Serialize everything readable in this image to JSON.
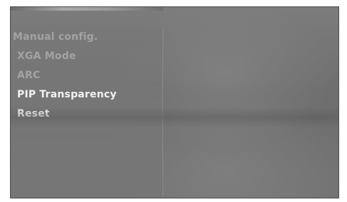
{
  "menu": {
    "items": [
      {
        "label": "Manual config.",
        "state": "dim"
      },
      {
        "label": "XGA Mode",
        "state": "dim"
      },
      {
        "label": "ARC",
        "state": "dim"
      },
      {
        "label": "PIP Transparency",
        "state": "bright"
      },
      {
        "label": "Reset",
        "state": "bright"
      }
    ]
  },
  "colors": {
    "dim_text": "#a3a3a3",
    "bright_text": "#f2f2f2",
    "panel": "#787878",
    "background": "#6e6e6e"
  }
}
